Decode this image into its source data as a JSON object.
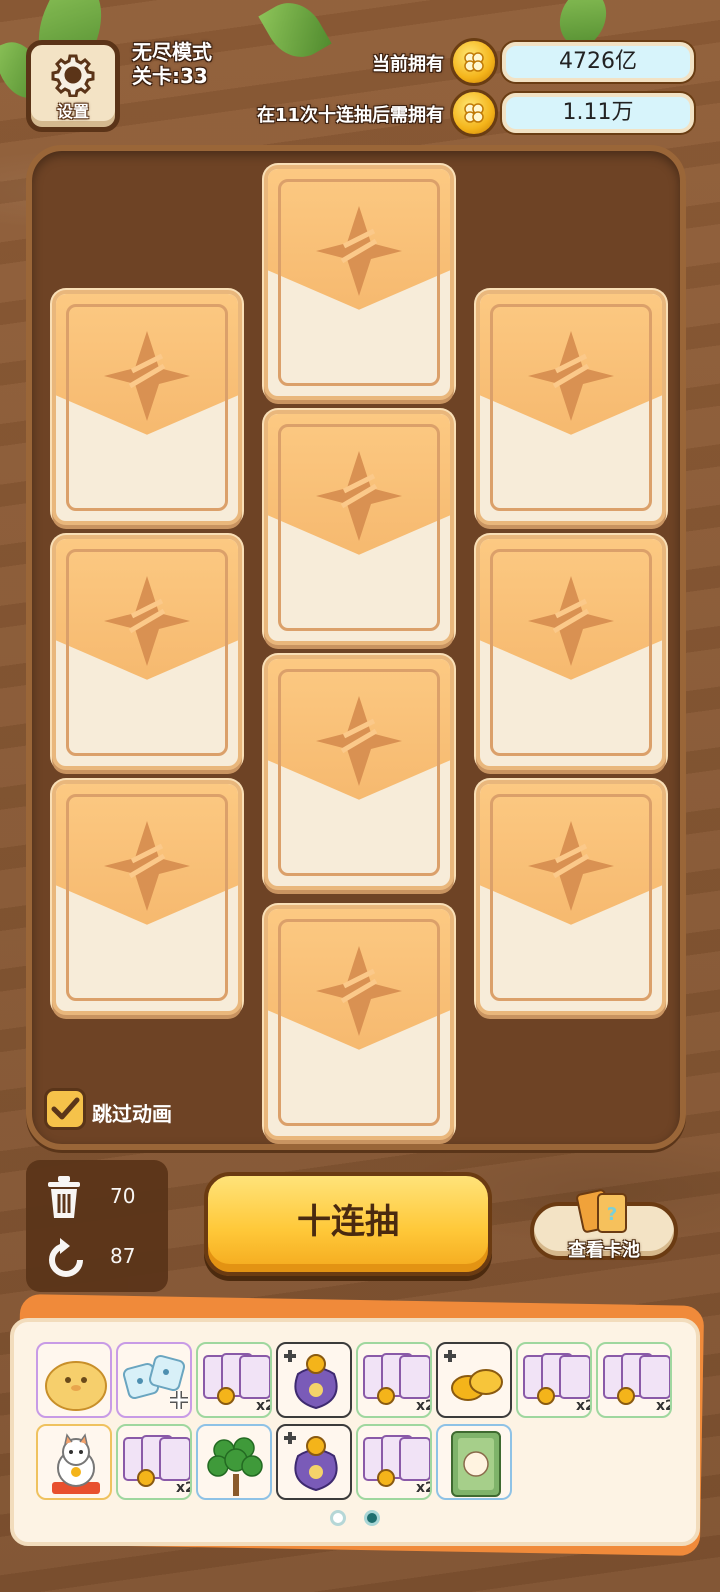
{
  "header": {
    "settings_label": "设置",
    "mode": "无尽模式",
    "level": "关卡:33",
    "current_label": "当前拥有",
    "current_value": "4726亿",
    "required_label": "在11次十连抽后需拥有",
    "required_value": "1.11万"
  },
  "board": {
    "card_count": 10,
    "skip_animation_label": "跳过动画",
    "skip_animation_checked": true
  },
  "controls": {
    "trash_count": "70",
    "refresh_count": "87",
    "draw_label": "十连抽",
    "view_pool_label": "查看卡池"
  },
  "rewards": {
    "row1": [
      "hamster-ball",
      "dice-plus",
      "card-pack-x2",
      "coin-bag-plus",
      "card-pack-x2",
      "coins-plus",
      "card-pack-x2",
      "card-pack-x2"
    ],
    "row2": [
      "lucky-cat",
      "card-pack-x2",
      "clover-tree",
      "coin-bag-plus",
      "card-pack-x2",
      "green-card"
    ],
    "x2_label": "x2",
    "page_count": 2,
    "active_page": 2
  },
  "colors": {
    "card_top": "#fcc982",
    "card_bottom": "#f7ecd9",
    "draw_button": "#ffc93a",
    "board_bg": "#6e4325"
  }
}
